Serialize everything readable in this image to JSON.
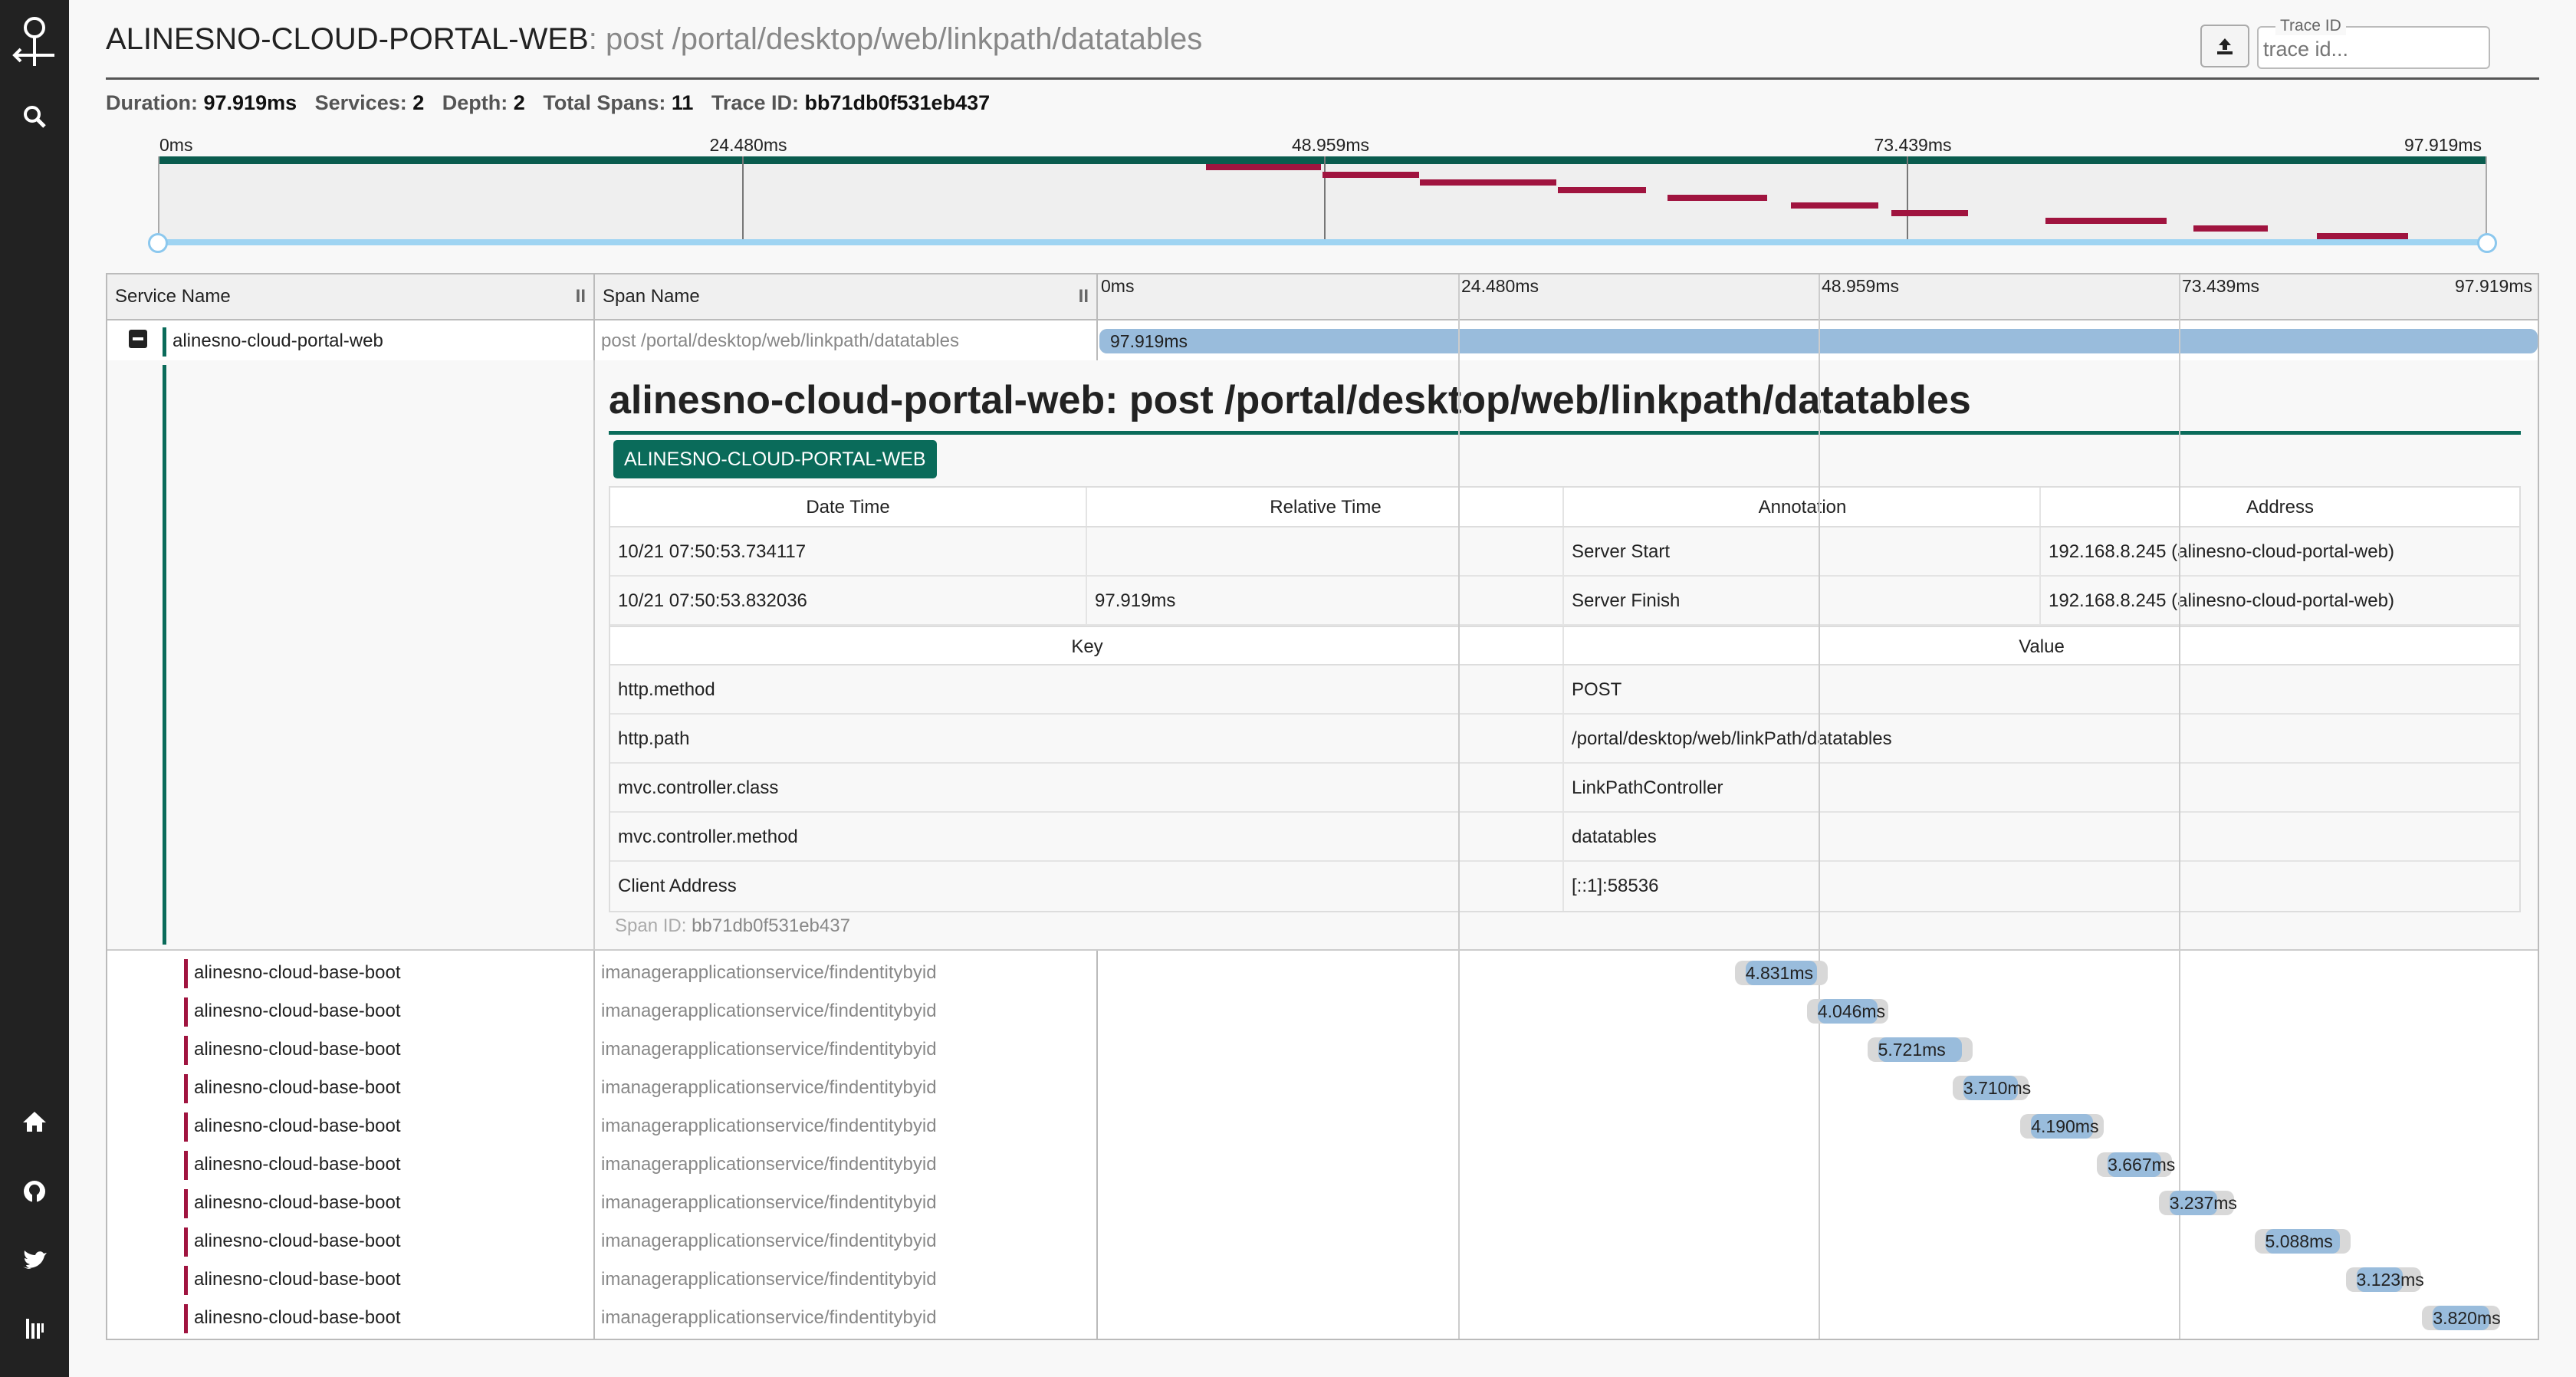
{
  "sidebar": {
    "logo_icon": "zipkin-logo-icon",
    "search_icon": "search-icon",
    "home_icon": "home-icon",
    "github_icon": "github-icon",
    "twitter_icon": "twitter-icon",
    "gitter_icon": "gitter-icon"
  },
  "header": {
    "service": "ALINESNO-CLOUD-PORTAL-WEB",
    "span": ": post /portal/desktop/web/linkpath/datatables",
    "trace_id_label": "Trace ID",
    "trace_id_placeholder": "trace id..."
  },
  "stats": {
    "duration_label": "Duration:",
    "duration": "97.919ms",
    "services_label": "Services:",
    "services": "2",
    "depth_label": "Depth:",
    "depth": "2",
    "spans_label": "Total Spans:",
    "spans": "11",
    "traceid_label": "Trace ID:",
    "traceid": "bb71db0f531eb437"
  },
  "timeline": {
    "total_ms": 97.919,
    "ticks": [
      "0ms",
      "24.480ms",
      "48.959ms",
      "73.439ms",
      "97.919ms"
    ]
  },
  "table": {
    "col_service": "Service Name",
    "col_span": "Span Name",
    "grip": "II"
  },
  "root_span": {
    "service": "alinesno-cloud-portal-web",
    "name": "post /portal/desktop/web/linkpath/datatables",
    "duration_label": "97.919ms",
    "start_ms": 0,
    "duration_ms": 97.919
  },
  "detail": {
    "title": "alinesno-cloud-portal-web: post /portal/desktop/web/linkpath/datatables",
    "badge": "ALINESNO-CLOUD-PORTAL-WEB",
    "ann_headers": [
      "Date Time",
      "Relative Time",
      "Annotation",
      "Address"
    ],
    "annotations": [
      {
        "date": "10/21 07:50:53.734117",
        "rel": "",
        "ann": "Server Start",
        "addr": "192.168.8.245 (alinesno-cloud-portal-web)"
      },
      {
        "date": "10/21 07:50:53.832036",
        "rel": "97.919ms",
        "ann": "Server Finish",
        "addr": "192.168.8.245 (alinesno-cloud-portal-web)"
      }
    ],
    "tag_headers": [
      "Key",
      "Value"
    ],
    "tags": [
      {
        "k": "http.method",
        "v": "POST"
      },
      {
        "k": "http.path",
        "v": "/portal/desktop/web/linkPath/datatables"
      },
      {
        "k": "mvc.controller.class",
        "v": "LinkPathController"
      },
      {
        "k": "mvc.controller.method",
        "v": "datatables"
      },
      {
        "k": "Client Address",
        "v": "[::1]:58536"
      }
    ],
    "span_id_label": "Span ID:",
    "span_id": "bb71db0f531eb437"
  },
  "child_spans": [
    {
      "service": "alinesno-cloud-base-boot",
      "name": "imanagerapplicationservice/findentitybyid",
      "label": "4.831ms",
      "start_ms": 44.0,
      "duration_ms": 4.831
    },
    {
      "service": "alinesno-cloud-base-boot",
      "name": "imanagerapplicationservice/findentitybyid",
      "label": "4.046ms",
      "start_ms": 48.9,
      "duration_ms": 4.046
    },
    {
      "service": "alinesno-cloud-base-boot",
      "name": "imanagerapplicationservice/findentitybyid",
      "label": "5.721ms",
      "start_ms": 53.0,
      "duration_ms": 5.721
    },
    {
      "service": "alinesno-cloud-base-boot",
      "name": "imanagerapplicationservice/findentitybyid",
      "label": "3.710ms",
      "start_ms": 58.8,
      "duration_ms": 3.71
    },
    {
      "service": "alinesno-cloud-base-boot",
      "name": "imanagerapplicationservice/findentitybyid",
      "label": "4.190ms",
      "start_ms": 63.4,
      "duration_ms": 4.19
    },
    {
      "service": "alinesno-cloud-base-boot",
      "name": "imanagerapplicationservice/findentitybyid",
      "label": "3.667ms",
      "start_ms": 68.6,
      "duration_ms": 3.667
    },
    {
      "service": "alinesno-cloud-base-boot",
      "name": "imanagerapplicationservice/findentitybyid",
      "label": "3.237ms",
      "start_ms": 72.8,
      "duration_ms": 3.237
    },
    {
      "service": "alinesno-cloud-base-boot",
      "name": "imanagerapplicationservice/findentitybyid",
      "label": "5.088ms",
      "start_ms": 79.3,
      "duration_ms": 5.088
    },
    {
      "service": "alinesno-cloud-base-boot",
      "name": "imanagerapplicationservice/findentitybyid",
      "label": "3.123ms",
      "start_ms": 85.5,
      "duration_ms": 3.123
    },
    {
      "service": "alinesno-cloud-base-boot",
      "name": "imanagerapplicationservice/findentitybyid",
      "label": "3.820ms",
      "start_ms": 90.7,
      "duration_ms": 3.82
    }
  ],
  "colors": {
    "root_service": "#0a6b5a",
    "child_service": "#a0143f",
    "bar_blue": "#99bcdc",
    "bar_gray": "#d8d8d8"
  }
}
